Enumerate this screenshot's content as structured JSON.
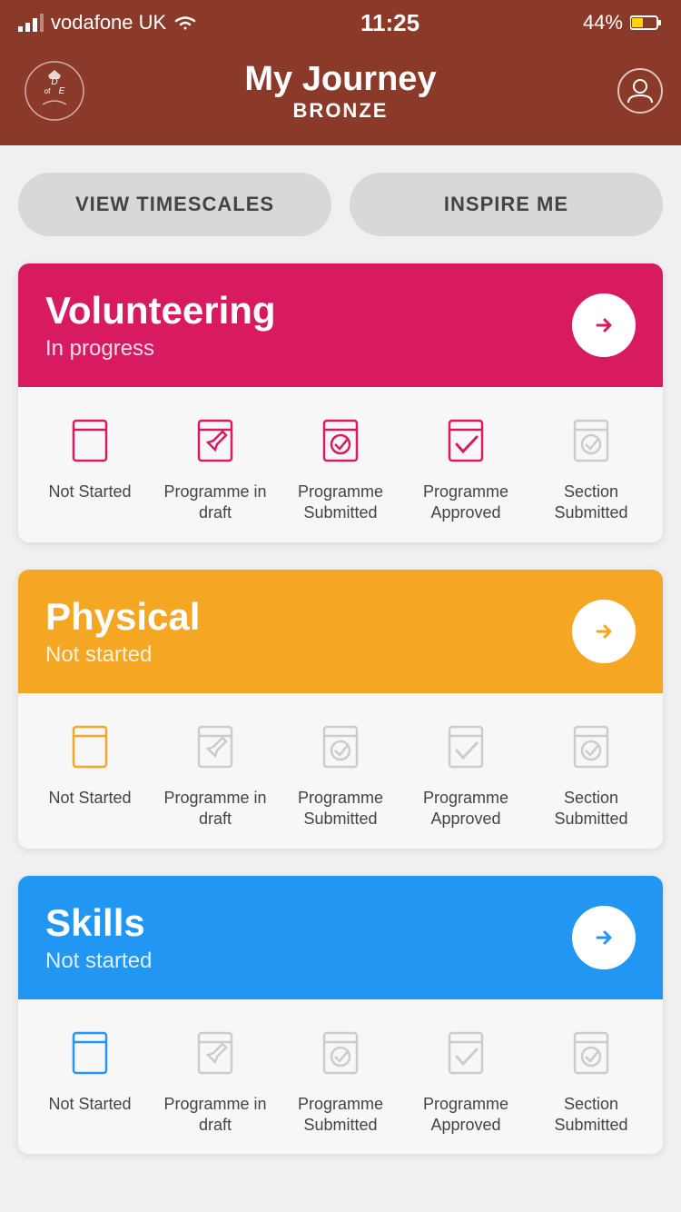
{
  "statusBar": {
    "carrier": "vodafone UK",
    "time": "11:25",
    "battery": "44%"
  },
  "header": {
    "title": "My Journey",
    "subtitle": "BRONZE"
  },
  "buttons": {
    "viewTimescales": "VIEW TIMESCALES",
    "inspireMe": "INSPIRE ME"
  },
  "sections": [
    {
      "id": "volunteering",
      "title": "Volunteering",
      "status": "In progress",
      "color": "volunteering",
      "arrowColor": "#D81B60",
      "iconColor": "#D81B60",
      "activeIndex": 0,
      "statuses": [
        {
          "label": "Not Started",
          "active": true
        },
        {
          "label": "Programme\nin draft",
          "active": false
        },
        {
          "label": "Programme\nSubmitted",
          "active": false
        },
        {
          "label": "Programme\nApproved",
          "active": false
        },
        {
          "label": "Section\nSubmitted",
          "active": false
        }
      ]
    },
    {
      "id": "physical",
      "title": "Physical",
      "status": "Not started",
      "color": "physical",
      "arrowColor": "#F5A623",
      "iconColor": "#F5A623",
      "activeIndex": 0,
      "statuses": [
        {
          "label": "Not Started",
          "active": true
        },
        {
          "label": "Programme\nin draft",
          "active": false
        },
        {
          "label": "Programme\nSubmitted",
          "active": false
        },
        {
          "label": "Programme\nApproved",
          "active": false
        },
        {
          "label": "Section\nSubmitted",
          "active": false
        }
      ]
    },
    {
      "id": "skills",
      "title": "Skills",
      "status": "Not started",
      "color": "skills",
      "arrowColor": "#2196F3",
      "iconColor": "#2196F3",
      "activeIndex": 0,
      "statuses": [
        {
          "label": "Not Started",
          "active": true
        },
        {
          "label": "Programme\nin draft",
          "active": false
        },
        {
          "label": "Programme\nSubmitted",
          "active": false
        },
        {
          "label": "Programme\nApproved",
          "active": false
        },
        {
          "label": "Section\nSubmitted",
          "active": false
        }
      ]
    }
  ]
}
